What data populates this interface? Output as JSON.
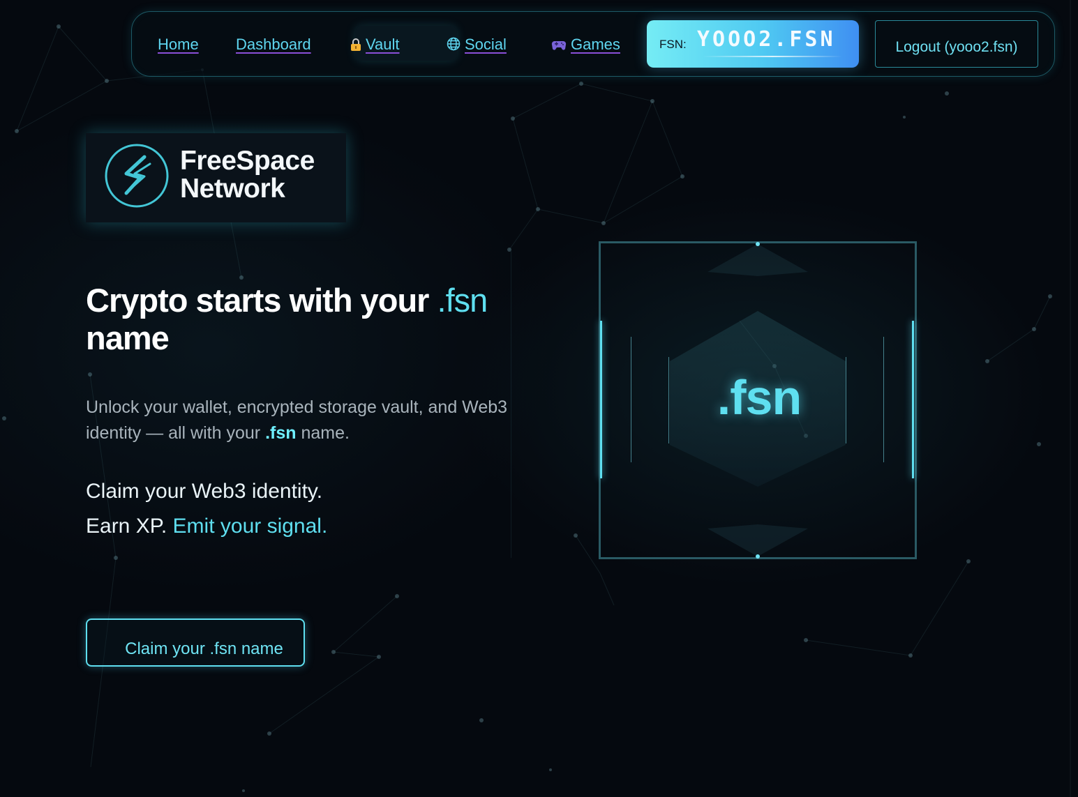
{
  "nav": {
    "items": [
      {
        "label": "Home",
        "icon": ""
      },
      {
        "label": "Dashboard",
        "icon": ""
      },
      {
        "label": "Vault",
        "icon": "lock-icon"
      },
      {
        "label": "Social",
        "icon": "globe-icon"
      },
      {
        "label": "Games",
        "icon": "gamepad-icon"
      }
    ],
    "fsn_prefix": "FSN:",
    "fsn_name": "YOOO2.FSN",
    "logout_label": "Logout (yooo2.fsn)"
  },
  "brand": {
    "line1": "FreeSpace",
    "line2": "Network"
  },
  "hero": {
    "headline_part1": "Crypto starts with your",
    "headline_accent": ".fsn",
    "headline_part2": "name",
    "sub_part1": "Unlock your wallet, encrypted storage vault, and Web3 identity — all with your",
    "sub_highlight": ".fsn",
    "sub_part2": "name.",
    "tagline1": "Claim your Web3 identity.",
    "tagline2_plain": "Earn XP.",
    "tagline2_accent": "Emit your signal.",
    "cta_label": "Claim your .fsn name"
  },
  "visual": {
    "center_label": ".fsn"
  },
  "colors": {
    "accent": "#5fdff0",
    "background": "#05090f",
    "pill_gradient_start": "#75ecf4",
    "pill_gradient_end": "#3f8ff2",
    "link_underline": "#8a4fd8"
  }
}
